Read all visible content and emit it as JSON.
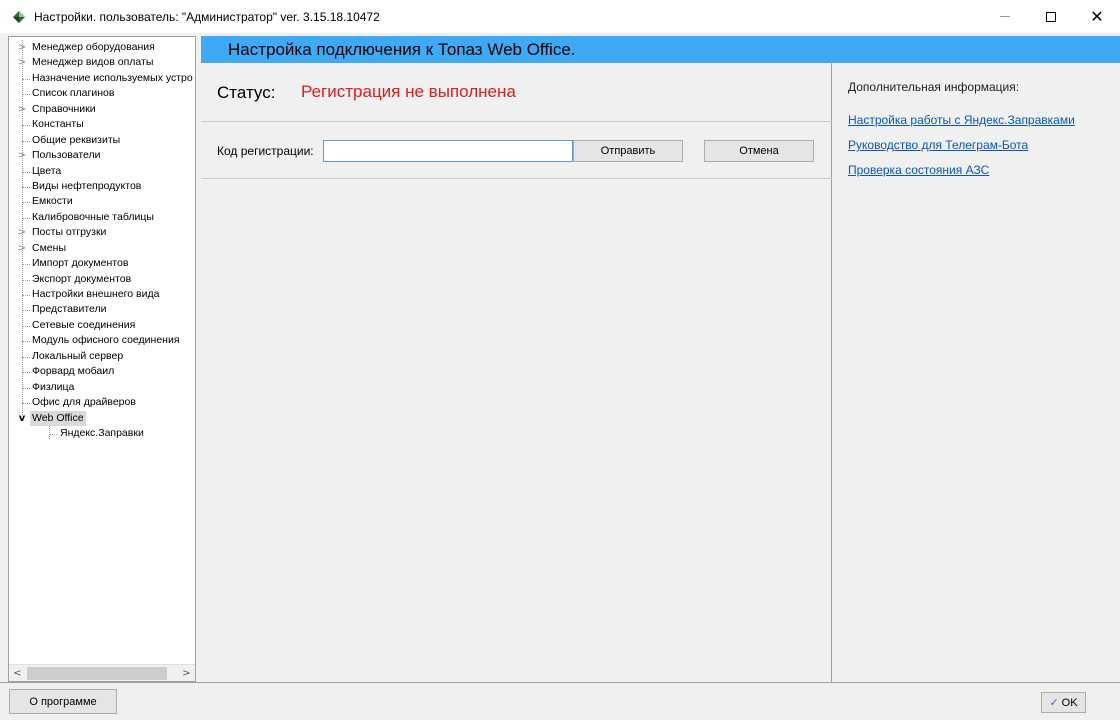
{
  "window": {
    "title": "Настройки. пользователь: \"Администратор\" ver. 3.15.18.10472",
    "icons": {
      "app": "app-diamond-icon",
      "minimize": "minimize-icon",
      "maximize": "maximize-icon",
      "close": "close-icon"
    }
  },
  "tree": {
    "items": [
      {
        "label": "Менеджер оборудования",
        "expander": ">"
      },
      {
        "label": "Менеджер видов оплаты",
        "expander": ">"
      },
      {
        "label": "Назначение используемых устро",
        "expander": ""
      },
      {
        "label": "Список плагинов",
        "expander": ""
      },
      {
        "label": "Справочники",
        "expander": ">"
      },
      {
        "label": "Константы",
        "expander": ""
      },
      {
        "label": "Общие реквизиты",
        "expander": ""
      },
      {
        "label": "Пользователи",
        "expander": ">"
      },
      {
        "label": "Цвета",
        "expander": ""
      },
      {
        "label": "Виды нефтепродуктов",
        "expander": ""
      },
      {
        "label": "Емкости",
        "expander": ""
      },
      {
        "label": "Калибровочные таблицы",
        "expander": ""
      },
      {
        "label": "Посты отгрузки",
        "expander": ">"
      },
      {
        "label": "Смены",
        "expander": ">"
      },
      {
        "label": "Импорт документов",
        "expander": ""
      },
      {
        "label": "Экспорт документов",
        "expander": ""
      },
      {
        "label": "Настройки внешнего вида",
        "expander": ""
      },
      {
        "label": "Представители",
        "expander": ""
      },
      {
        "label": "Сетевые соединения",
        "expander": ""
      },
      {
        "label": "Модуль офисного соединения",
        "expander": ""
      },
      {
        "label": "Локальный сервер",
        "expander": ""
      },
      {
        "label": "Форвард мобаил",
        "expander": ""
      },
      {
        "label": "Физлица",
        "expander": ""
      },
      {
        "label": "Офис для драйверов",
        "expander": ""
      },
      {
        "label": "Web Office",
        "expander": "v",
        "selected": true,
        "expanded": true
      },
      {
        "label": "Яндекс.Заправки",
        "expander": "",
        "child": true
      }
    ],
    "scroll_left": "<",
    "scroll_right": ">"
  },
  "header": {
    "title": "Настройка подключения к Топаз Web Office."
  },
  "status": {
    "label": "Статус:",
    "value": "Регистрация не выполнена",
    "value_color": "#e41b17"
  },
  "registration": {
    "label": "Код регистрации:",
    "value": "",
    "send_label": "Отправить",
    "cancel_label": "Отмена"
  },
  "info": {
    "title": "Дополнительная информация:",
    "links": [
      "Настройка работы с Яндекс.Заправками",
      "Руководство для Телеграм-Бота",
      "Проверка состояния АЗС"
    ]
  },
  "footer": {
    "about_label": "О программе",
    "ok_label": "OK",
    "ok_icon": "check-icon"
  },
  "colors": {
    "header_bg": "#3ea9f5",
    "link": "#0a55c2",
    "status_error": "#e41b17"
  }
}
